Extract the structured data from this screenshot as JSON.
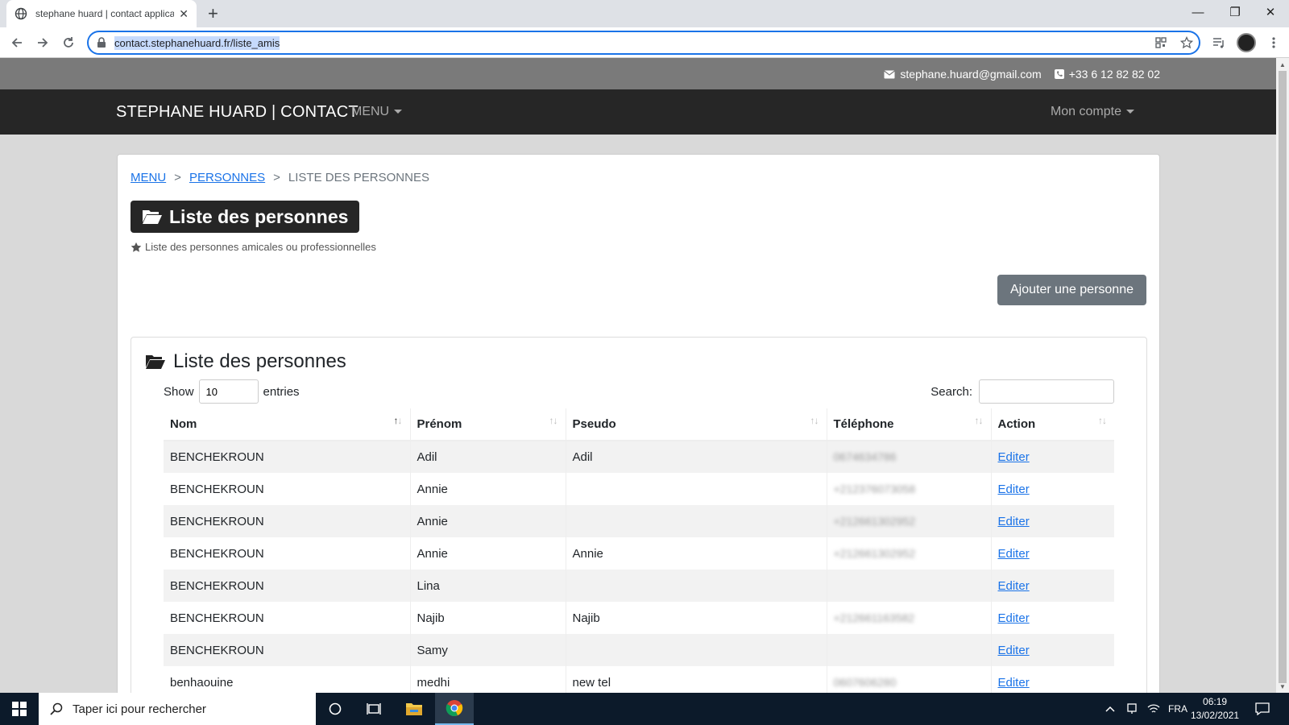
{
  "browser": {
    "tab_title": "stephane huard | contact application",
    "tab_close": "✕",
    "new_tab": "+",
    "url": "contact.stephanehuard.fr/liste_amis",
    "win_minimize": "—",
    "win_restore": "❐",
    "win_close": "✕"
  },
  "topbar": {
    "email": "stephane.huard@gmail.com",
    "phone": "+33 6 12 82 82 02"
  },
  "navbar": {
    "brand": "STEPHANE HUARD | CONTACT",
    "menu": "MENU",
    "account": "Mon compte"
  },
  "breadcrumb": {
    "item1": "MENU",
    "item2": "PERSONNES",
    "current": "LISTE DES PERSONNES",
    "separator": ">"
  },
  "page": {
    "title": "Liste des personnes",
    "subtitle": "Liste des personnes amicales ou professionnelles",
    "add_button": "Ajouter une personne"
  },
  "panel": {
    "title": "Liste des personnes",
    "show_label": "Show",
    "entries_value": "10",
    "entries_label": "entries",
    "search_label": "Search:"
  },
  "table": {
    "headers": [
      "Nom",
      "Prénom",
      "Pseudo",
      "Téléphone",
      "Action"
    ],
    "rows": [
      [
        "BENCHEKROUN",
        "Adil",
        "Adil",
        "0674634786",
        "Editer"
      ],
      [
        "BENCHEKROUN",
        "Annie",
        "",
        "+212376073058",
        "Editer"
      ],
      [
        "BENCHEKROUN",
        "Annie",
        "",
        "+212661302952",
        "Editer"
      ],
      [
        "BENCHEKROUN",
        "Annie",
        "Annie",
        "+212661302952",
        "Editer"
      ],
      [
        "BENCHEKROUN",
        "Lina",
        "",
        "",
        "Editer"
      ],
      [
        "BENCHEKROUN",
        "Najib",
        "Najib",
        "+212661163582",
        "Editer"
      ],
      [
        "BENCHEKROUN",
        "Samy",
        "",
        "",
        "Editer"
      ],
      [
        "benhaouine",
        "medhi",
        "new tel",
        "0607606280",
        "Editer"
      ]
    ]
  },
  "taskbar": {
    "search_placeholder": "Taper ici pour rechercher",
    "lang": "FRA",
    "time": "06:19",
    "date": "13/02/2021"
  }
}
